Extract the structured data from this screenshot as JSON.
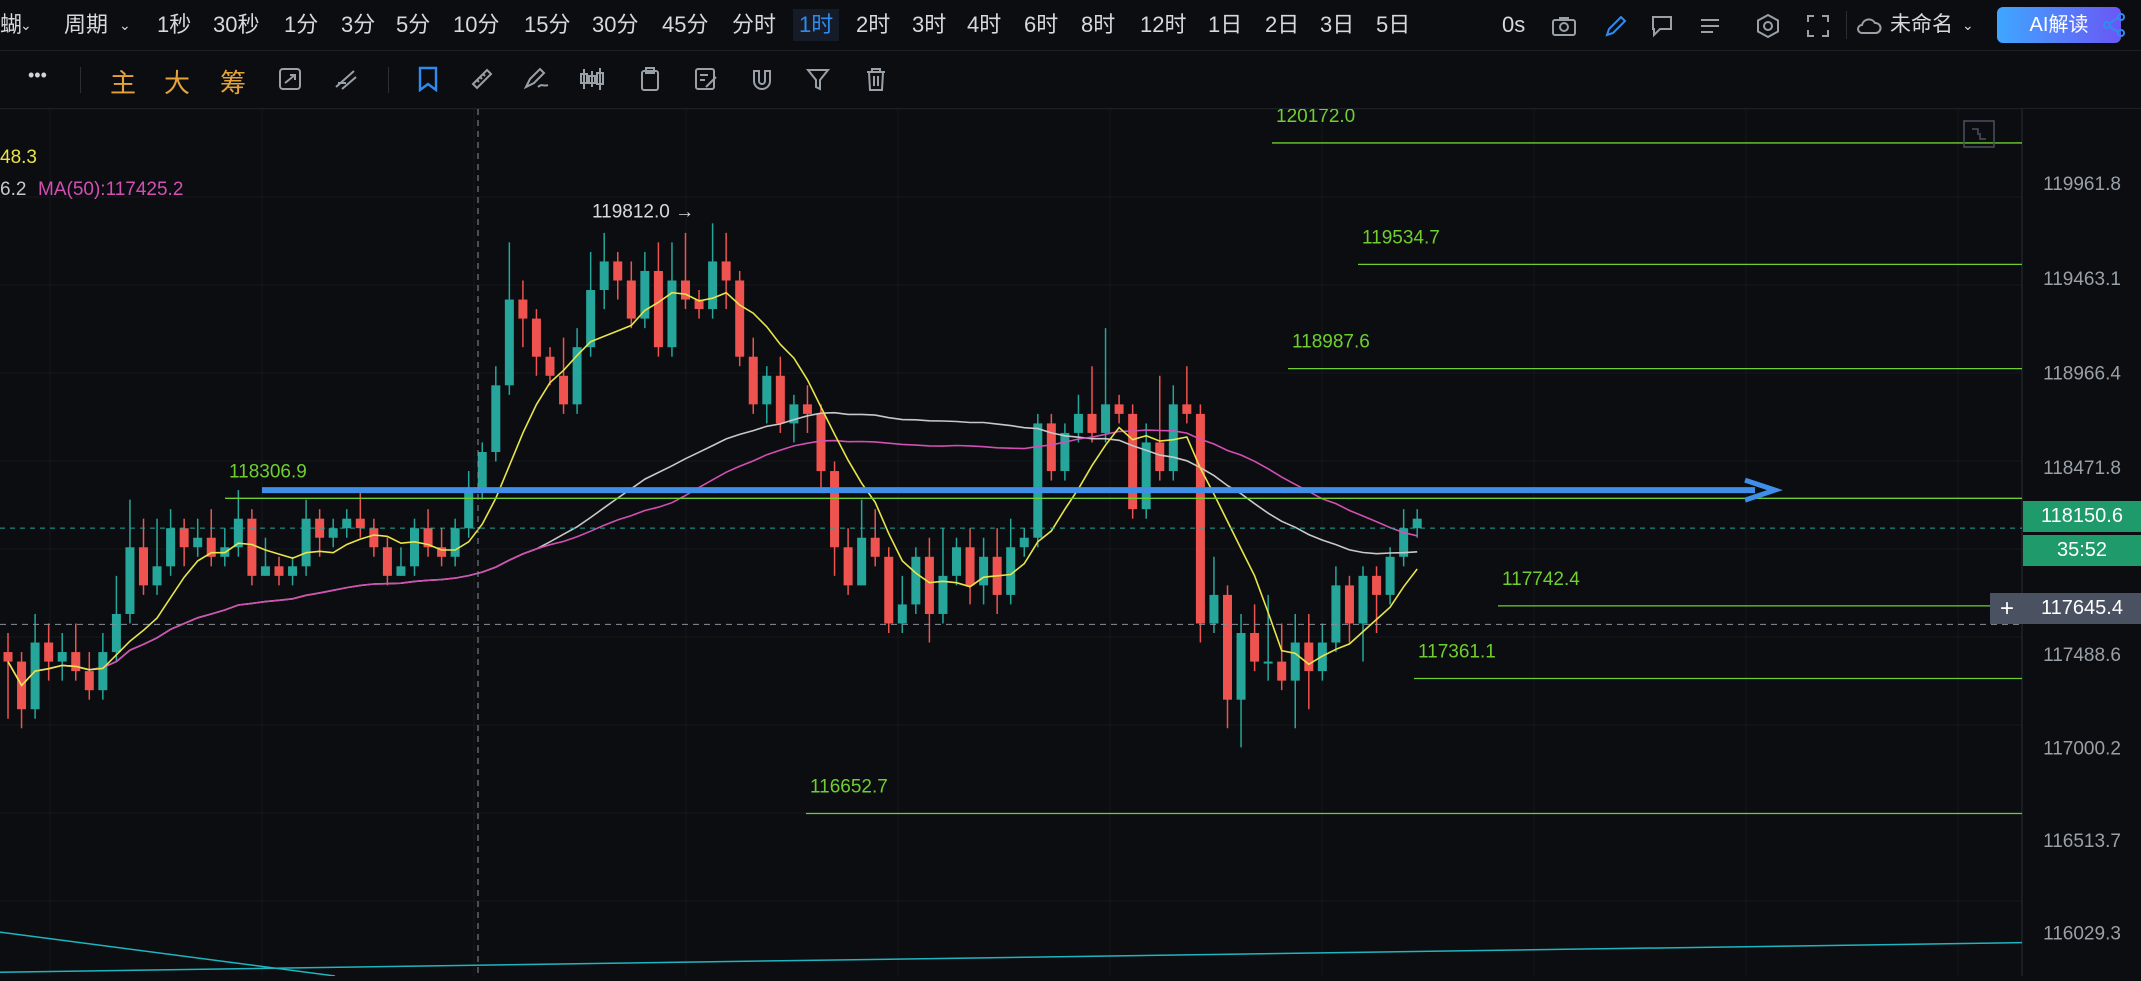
{
  "topbar": {
    "cut_label": "蝴",
    "period_label": "周期",
    "timeframes": [
      "1秒",
      "30秒",
      "1分",
      "3分",
      "5分",
      "10分",
      "15分",
      "30分",
      "45分",
      "分时",
      "1时",
      "2时",
      "3时",
      "4时",
      "6时",
      "8时",
      "12时",
      "1日",
      "2日",
      "3日",
      "5日"
    ],
    "active_timeframe": "1时",
    "countdown_label": "0s",
    "layout_name": "未命名",
    "ai_button": "AI解读"
  },
  "toolbar2": {
    "more_label": "•••",
    "chars": [
      "主",
      "大",
      "筹"
    ]
  },
  "legend": {
    "line1": "48.3",
    "line2_prefix": "6.2",
    "ma50": "MA(50):117425.2"
  },
  "price_axis": {
    "ticks": [
      "119961.8",
      "119463.1",
      "118966.4",
      "118471.8",
      "117488.6",
      "117000.2",
      "116513.7",
      "116029.3"
    ],
    "current_price": "118150.6",
    "countdown": "35:52",
    "crosshair_price": "117645.4"
  },
  "colors": {
    "up": "#26a69a",
    "down": "#ef5350",
    "ma_yellow": "#e8e44a",
    "ma_pink": "#d34fb4",
    "ma_white": "#c8c8c8",
    "level_line": "#6fcf2f",
    "arrow": "#3f8fe8",
    "trend": "#1fb5c0",
    "accent": "#2e8cf0"
  },
  "chart_data": {
    "type": "candlestick",
    "interval": "1时",
    "ylim": [
      115800,
      120350
    ],
    "price_levels": [
      {
        "label": "120172.0",
        "value": 120172.0
      },
      {
        "label": "119534.7",
        "value": 119534.7
      },
      {
        "label": "118987.6",
        "value": 118987.6
      },
      {
        "label": "118306.9",
        "value": 118306.9
      },
      {
        "label": "117742.4",
        "value": 117742.4
      },
      {
        "label": "117361.1",
        "value": 117361.1
      },
      {
        "label": "116652.7",
        "value": 116652.7
      }
    ],
    "high_annotation": {
      "label": "119812.0 →",
      "value": 119812.0
    },
    "candles": [
      [
        117500,
        117450,
        117600,
        117150
      ],
      [
        117450,
        117200,
        117500,
        117100
      ],
      [
        117200,
        117550,
        117700,
        117150
      ],
      [
        117550,
        117450,
        117650,
        117350
      ],
      [
        117450,
        117500,
        117600,
        117350
      ],
      [
        117500,
        117400,
        117650,
        117350
      ],
      [
        117400,
        117300,
        117500,
        117250
      ],
      [
        117300,
        117500,
        117600,
        117250
      ],
      [
        117500,
        117700,
        117900,
        117450
      ],
      [
        117700,
        118050,
        118300,
        117650
      ],
      [
        118050,
        117850,
        118200,
        117800
      ],
      [
        117850,
        117950,
        118200,
        117800
      ],
      [
        117950,
        118150,
        118250,
        117900
      ],
      [
        118150,
        118050,
        118200,
        117950
      ],
      [
        118050,
        118100,
        118200,
        118000
      ],
      [
        118100,
        118000,
        118250,
        117950
      ],
      [
        118000,
        118050,
        118150,
        117950
      ],
      [
        118050,
        118200,
        118350,
        118000
      ],
      [
        118200,
        117900,
        118250,
        117850
      ],
      [
        117900,
        117950,
        118100,
        117900
      ],
      [
        117950,
        117900,
        118000,
        117850
      ],
      [
        117900,
        117950,
        118000,
        117850
      ],
      [
        117950,
        118200,
        118300,
        117900
      ],
      [
        118200,
        118100,
        118250,
        118000
      ],
      [
        118100,
        118150,
        118200,
        118050
      ],
      [
        118150,
        118200,
        118250,
        118100
      ],
      [
        118200,
        118150,
        118350,
        118100
      ],
      [
        118150,
        118050,
        118200,
        118000
      ],
      [
        118050,
        117900,
        118100,
        117850
      ],
      [
        117900,
        117950,
        118050,
        117900
      ],
      [
        117950,
        118150,
        118200,
        117900
      ],
      [
        118150,
        118050,
        118250,
        118000
      ],
      [
        118050,
        118000,
        118150,
        117950
      ],
      [
        118000,
        118150,
        118200,
        117950
      ],
      [
        118150,
        118350,
        118450,
        118100
      ],
      [
        118350,
        118550,
        118600,
        118300
      ],
      [
        118550,
        118900,
        119000,
        118500
      ],
      [
        118900,
        119350,
        119650,
        118850
      ],
      [
        119350,
        119250,
        119450,
        119100
      ],
      [
        119250,
        119050,
        119300,
        118950
      ],
      [
        119050,
        118950,
        119100,
        118900
      ],
      [
        118950,
        118800,
        119150,
        118750
      ],
      [
        118800,
        119100,
        119200,
        118750
      ],
      [
        119100,
        119400,
        119600,
        119050
      ],
      [
        119400,
        119550,
        119700,
        119300
      ],
      [
        119550,
        119450,
        119600,
        119350
      ],
      [
        119450,
        119250,
        119550,
        119200
      ],
      [
        119250,
        119500,
        119600,
        119200
      ],
      [
        119500,
        119100,
        119650,
        119050
      ],
      [
        119100,
        119450,
        119650,
        119050
      ],
      [
        119450,
        119350,
        119700,
        119300
      ],
      [
        119350,
        119300,
        119400,
        119250
      ],
      [
        119300,
        119550,
        119750,
        119250
      ],
      [
        119550,
        119450,
        119700,
        119300
      ],
      [
        119450,
        119050,
        119500,
        119000
      ],
      [
        119050,
        118800,
        119150,
        118750
      ],
      [
        118800,
        118950,
        119000,
        118700
      ],
      [
        118950,
        118700,
        119050,
        118650
      ],
      [
        118700,
        118800,
        118850,
        118600
      ],
      [
        118800,
        118750,
        118900,
        118650
      ],
      [
        118750,
        118450,
        118800,
        118350
      ],
      [
        118450,
        118050,
        118500,
        117900
      ],
      [
        118050,
        117850,
        118150,
        117800
      ],
      [
        117850,
        118100,
        118300,
        117850
      ],
      [
        118100,
        118000,
        118250,
        117950
      ],
      [
        118000,
        117650,
        118050,
        117600
      ],
      [
        117650,
        117750,
        117900,
        117600
      ],
      [
        117750,
        118000,
        118050,
        117700
      ],
      [
        118000,
        117700,
        118100,
        117550
      ],
      [
        117700,
        117900,
        118150,
        117650
      ],
      [
        117900,
        118050,
        118100,
        117850
      ],
      [
        118050,
        117850,
        118150,
        117750
      ],
      [
        117850,
        118000,
        118100,
        117750
      ],
      [
        118000,
        117800,
        118150,
        117700
      ],
      [
        117800,
        118050,
        118200,
        117750
      ],
      [
        118050,
        118100,
        118150,
        118000
      ],
      [
        118100,
        118700,
        118750,
        118050
      ],
      [
        118700,
        118450,
        118750,
        118400
      ],
      [
        118450,
        118650,
        118700,
        118400
      ],
      [
        118650,
        118750,
        118850,
        118600
      ],
      [
        118750,
        118650,
        119000,
        118600
      ],
      [
        118650,
        118800,
        119200,
        118600
      ],
      [
        118800,
        118750,
        118850,
        118700
      ],
      [
        118750,
        118250,
        118800,
        118200
      ],
      [
        118250,
        118600,
        118700,
        118200
      ],
      [
        118600,
        118450,
        118950,
        118400
      ],
      [
        118450,
        118800,
        118900,
        118400
      ],
      [
        118800,
        118750,
        119000,
        118700
      ],
      [
        118750,
        117650,
        118800,
        117550
      ],
      [
        117650,
        117800,
        118000,
        117600
      ],
      [
        117800,
        117250,
        117850,
        117100
      ],
      [
        117250,
        117600,
        117700,
        117000
      ],
      [
        117600,
        117450,
        117750,
        117400
      ],
      [
        117450,
        117450,
        117800,
        117350
      ],
      [
        117450,
        117350,
        117650,
        117300
      ],
      [
        117350,
        117550,
        117700,
        117100
      ],
      [
        117550,
        117400,
        117700,
        117200
      ],
      [
        117400,
        117550,
        117650,
        117350
      ],
      [
        117550,
        117850,
        117950,
        117500
      ],
      [
        117850,
        117650,
        117900,
        117550
      ],
      [
        117650,
        117900,
        117950,
        117450
      ],
      [
        117900,
        117800,
        117950,
        117600
      ],
      [
        117800,
        118000,
        118050,
        117750
      ],
      [
        118000,
        118150,
        118250,
        117950
      ],
      [
        118150,
        118200,
        118250,
        118100
      ]
    ]
  }
}
